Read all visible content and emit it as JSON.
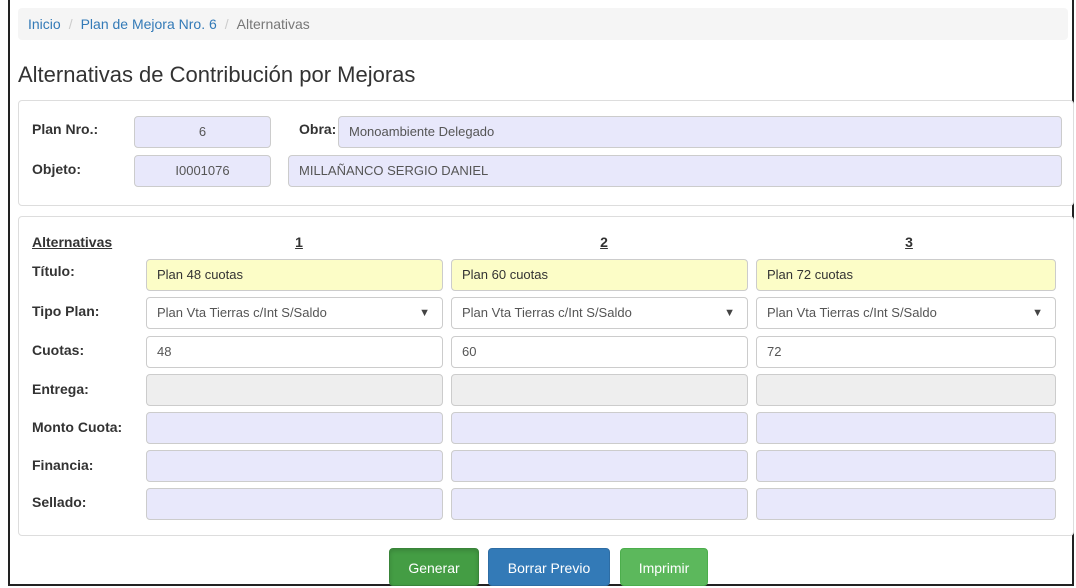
{
  "breadcrumb": {
    "home": "Inicio",
    "plan": "Plan de Mejora Nro. 6",
    "current": "Alternativas",
    "separator": "/"
  },
  "page_title": "Alternativas de Contribución por Mejoras",
  "info": {
    "plan_label": "Plan Nro.:",
    "plan_value": "6",
    "obra_label": "Obra:",
    "obra_value": "Monoambiente Delegado",
    "objeto_label": "Objeto:",
    "objeto_code": "I0001076",
    "objeto_name": "MILLAÑANCO SERGIO DANIEL"
  },
  "alternatives": {
    "header_label": "Alternativas",
    "columns": [
      "1",
      "2",
      "3"
    ],
    "row_labels": {
      "titulo": "Título:",
      "tipo_plan": "Tipo Plan:",
      "cuotas": "Cuotas:",
      "entrega": "Entrega:",
      "monto_cuota": "Monto Cuota:",
      "financia": "Financia:",
      "sellado": "Sellado:"
    },
    "titulos": [
      "Plan 48 cuotas",
      "Plan 60 cuotas",
      "Plan 72 cuotas"
    ],
    "tipos_plan": [
      "Plan Vta Tierras c/Int S/Saldo",
      "Plan Vta Tierras c/Int S/Saldo",
      "Plan Vta Tierras c/Int S/Saldo"
    ],
    "cuotas": [
      "48",
      "60",
      "72"
    ],
    "entrega": [
      "",
      "",
      ""
    ],
    "monto_cuota": [
      "",
      "",
      ""
    ],
    "financia": [
      "",
      "",
      ""
    ],
    "sellado": [
      "",
      "",
      ""
    ]
  },
  "buttons": {
    "generar": "Generar",
    "borrar_previo": "Borrar Previo",
    "imprimir": "Imprimir"
  },
  "colors": {
    "generar": "#449d44",
    "borrar_previo": "#337ab7",
    "imprimir": "#5cb85c",
    "readonly_bg": "#e8e8fb",
    "titulo_bg": "#fcfdc7"
  },
  "icons": {
    "select_arrow": "▼"
  }
}
